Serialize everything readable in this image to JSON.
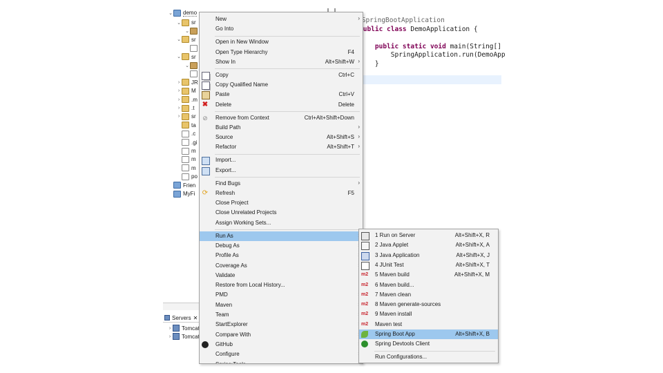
{
  "explorer": {
    "project_label": "demo",
    "rows": [
      {
        "icon": "source-folder-icon",
        "label": "sr"
      },
      {
        "icon": "package-icon",
        "label": ""
      },
      {
        "icon": "source-folder-icon",
        "label": "sr"
      },
      {
        "icon": "file-icon",
        "label": ""
      },
      {
        "icon": "source-folder-icon",
        "label": "sr"
      },
      {
        "icon": "package-icon",
        "label": ""
      },
      {
        "icon": "file-icon",
        "label": ""
      },
      {
        "icon": "library-icon",
        "label": "JR"
      },
      {
        "icon": "library-icon",
        "label": "M"
      },
      {
        "icon": "folder-icon",
        "label": ".m"
      },
      {
        "icon": "folder-icon",
        "label": ".t"
      },
      {
        "icon": "folder-icon",
        "label": "sr"
      },
      {
        "icon": "folder-icon",
        "label": "ta"
      },
      {
        "icon": "file-icon",
        "label": ".c"
      },
      {
        "icon": "file-icon",
        "label": ".gi"
      },
      {
        "icon": "file-icon",
        "label": "m"
      },
      {
        "icon": "file-icon",
        "label": "m"
      },
      {
        "icon": "file-icon",
        "label": "m"
      },
      {
        "icon": "file-icon",
        "label": "po"
      },
      {
        "icon": "project-icon",
        "label": "Frien"
      },
      {
        "icon": "project-icon",
        "label": "MyFi"
      }
    ]
  },
  "editor": {
    "lines": [
      {
        "parts": [
          {
            "t": "@SpringBootApplication",
            "c": "ann"
          }
        ]
      },
      {
        "parts": [
          {
            "t": "public class ",
            "c": "kw"
          },
          {
            "t": "DemoApplication {",
            "c": ""
          }
        ]
      },
      {
        "parts": [
          {
            "t": "",
            "c": ""
          }
        ]
      },
      {
        "parts": [
          {
            "t": "    public static void ",
            "c": "kw"
          },
          {
            "t": "main(String[]",
            "c": ""
          }
        ]
      },
      {
        "parts": [
          {
            "t": "        SpringApplication.run(DemoApp",
            "c": ""
          }
        ]
      },
      {
        "parts": [
          {
            "t": "    }",
            "c": ""
          }
        ]
      }
    ]
  },
  "servers": {
    "tab_label": "Servers",
    "tab_close": "✕",
    "items": [
      "Tomcat v",
      "Tomcat v"
    ]
  },
  "context_menu": {
    "items": [
      {
        "label": "New",
        "shortcut": "",
        "submenu": true,
        "icon": "",
        "separator_after": false
      },
      {
        "label": "Go Into",
        "shortcut": "",
        "submenu": false,
        "icon": "",
        "separator_after": true
      },
      {
        "label": "Open in New Window",
        "shortcut": "",
        "submenu": false,
        "icon": "",
        "separator_after": false
      },
      {
        "label": "Open Type Hierarchy",
        "shortcut": "F4",
        "submenu": false,
        "icon": "",
        "separator_after": false
      },
      {
        "label": "Show In",
        "shortcut": "Alt+Shift+W",
        "submenu": true,
        "icon": "",
        "separator_after": true
      },
      {
        "label": "Copy",
        "shortcut": "Ctrl+C",
        "submenu": false,
        "icon": "copy-icon",
        "separator_after": false
      },
      {
        "label": "Copy Qualified Name",
        "shortcut": "",
        "submenu": false,
        "icon": "copy-icon",
        "separator_after": false
      },
      {
        "label": "Paste",
        "shortcut": "Ctrl+V",
        "submenu": false,
        "icon": "paste-icon",
        "separator_after": false
      },
      {
        "label": "Delete",
        "shortcut": "Delete",
        "submenu": false,
        "icon": "delete-icon",
        "separator_after": true
      },
      {
        "label": "Remove from Context",
        "shortcut": "Ctrl+Alt+Shift+Down",
        "submenu": false,
        "icon": "remove-context-icon",
        "separator_after": false
      },
      {
        "label": "Build Path",
        "shortcut": "",
        "submenu": true,
        "icon": "",
        "separator_after": false
      },
      {
        "label": "Source",
        "shortcut": "Alt+Shift+S",
        "submenu": true,
        "icon": "",
        "separator_after": false
      },
      {
        "label": "Refactor",
        "shortcut": "Alt+Shift+T",
        "submenu": true,
        "icon": "",
        "separator_after": true
      },
      {
        "label": "Import...",
        "shortcut": "",
        "submenu": false,
        "icon": "import-icon",
        "separator_after": false
      },
      {
        "label": "Export...",
        "shortcut": "",
        "submenu": false,
        "icon": "export-icon",
        "separator_after": true
      },
      {
        "label": "Find Bugs",
        "shortcut": "",
        "submenu": true,
        "icon": "",
        "separator_after": false
      },
      {
        "label": "Refresh",
        "shortcut": "F5",
        "submenu": false,
        "icon": "refresh-icon",
        "separator_after": false
      },
      {
        "label": "Close Project",
        "shortcut": "",
        "submenu": false,
        "icon": "",
        "separator_after": false
      },
      {
        "label": "Close Unrelated Projects",
        "shortcut": "",
        "submenu": false,
        "icon": "",
        "separator_after": false
      },
      {
        "label": "Assign Working Sets...",
        "shortcut": "",
        "submenu": false,
        "icon": "",
        "separator_after": true
      },
      {
        "label": "Run As",
        "shortcut": "",
        "submenu": true,
        "icon": "",
        "separator_after": false,
        "selected": true
      },
      {
        "label": "Debug As",
        "shortcut": "",
        "submenu": true,
        "icon": "",
        "separator_after": false
      },
      {
        "label": "Profile As",
        "shortcut": "",
        "submenu": true,
        "icon": "",
        "separator_after": false
      },
      {
        "label": "Coverage As",
        "shortcut": "",
        "submenu": true,
        "icon": "",
        "separator_after": false
      },
      {
        "label": "Validate",
        "shortcut": "",
        "submenu": false,
        "icon": "",
        "separator_after": false
      },
      {
        "label": "Restore from Local History...",
        "shortcut": "",
        "submenu": false,
        "icon": "",
        "separator_after": false
      },
      {
        "label": "PMD",
        "shortcut": "",
        "submenu": true,
        "icon": "",
        "separator_after": false
      },
      {
        "label": "Maven",
        "shortcut": "",
        "submenu": true,
        "icon": "",
        "separator_after": false
      },
      {
        "label": "Team",
        "shortcut": "",
        "submenu": true,
        "icon": "",
        "separator_after": false
      },
      {
        "label": "StartExplorer",
        "shortcut": "",
        "submenu": true,
        "icon": "",
        "separator_after": false
      },
      {
        "label": "Compare With",
        "shortcut": "",
        "submenu": true,
        "icon": "",
        "separator_after": false
      },
      {
        "label": "GitHub",
        "shortcut": "",
        "submenu": true,
        "icon": "github-icon",
        "separator_after": false
      },
      {
        "label": "Configure",
        "shortcut": "",
        "submenu": true,
        "icon": "",
        "separator_after": false
      },
      {
        "label": "Spring Tools",
        "shortcut": "",
        "submenu": true,
        "icon": "",
        "separator_after": false
      }
    ]
  },
  "run_as_submenu": {
    "items": [
      {
        "label": "1 Run on Server",
        "shortcut": "Alt+Shift+X, R",
        "icon": "server-icon",
        "selected": false
      },
      {
        "label": "2 Java Applet",
        "shortcut": "Alt+Shift+X, A",
        "icon": "java-applet-icon",
        "selected": false
      },
      {
        "label": "3 Java Application",
        "shortcut": "Alt+Shift+X, J",
        "icon": "java-application-icon",
        "selected": false
      },
      {
        "label": "4 JUnit Test",
        "shortcut": "Alt+Shift+X, T",
        "icon": "junit-icon",
        "selected": false
      },
      {
        "label": "5 Maven build",
        "shortcut": "Alt+Shift+X, M",
        "icon": "maven-icon",
        "selected": false
      },
      {
        "label": "6 Maven build...",
        "shortcut": "",
        "icon": "maven-icon",
        "selected": false
      },
      {
        "label": "7 Maven clean",
        "shortcut": "",
        "icon": "maven-icon",
        "selected": false
      },
      {
        "label": "8 Maven generate-sources",
        "shortcut": "",
        "icon": "maven-icon",
        "selected": false
      },
      {
        "label": "9 Maven install",
        "shortcut": "",
        "icon": "maven-icon",
        "selected": false
      },
      {
        "label": "Maven test",
        "shortcut": "",
        "icon": "maven-icon",
        "selected": false
      },
      {
        "label": "Spring Boot App",
        "shortcut": "Alt+Shift+X, B",
        "icon": "spring-boot-icon",
        "selected": true
      },
      {
        "label": "Spring Devtools Client",
        "shortcut": "",
        "icon": "spring-devtools-icon",
        "selected": false
      },
      {
        "label": "Run Configurations...",
        "shortcut": "",
        "icon": "",
        "selected": false,
        "separator_before": true
      }
    ]
  }
}
